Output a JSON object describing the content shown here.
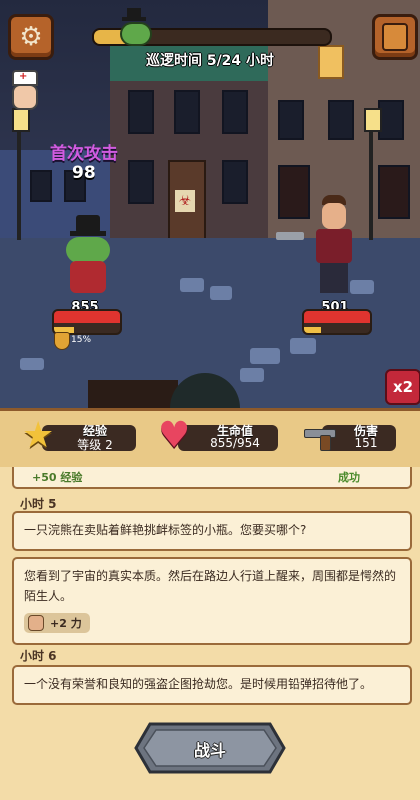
{
  "hud": {
    "patrol_label": "巡逻时间 5/24 小时",
    "patrol_progress": 0.21,
    "first_attack_label": "首次攻击",
    "first_attack_value": "98",
    "multiplier": "x2"
  },
  "player": {
    "hp": "855",
    "hp_fraction": 1.0,
    "energy_fraction": 0.3,
    "dodge": "15%"
  },
  "enemy": {
    "hp": "501",
    "hp_fraction": 1.0,
    "energy_fraction": 0.25
  },
  "stats": {
    "exp_label": "经验",
    "exp_value": "等级 2",
    "hp_label": "生命值",
    "hp_value": "855/954",
    "dmg_label": "伤害",
    "dmg_value": "151"
  },
  "log": {
    "partial_reward": "+50 经验",
    "partial_status": "成功",
    "entries": [
      {
        "hour": "小时 5",
        "text": "一只浣熊在卖贴着鲜艳挑衅标签的小瓶。您要买哪个?"
      },
      {
        "text": "您看到了宇宙的真实本质。然后在路边人行道上醒来，周围都是愕然的陌生人。",
        "reward": "+2 力"
      },
      {
        "hour": "小时 6",
        "text": "一个没有荣誉和良知的强盗企图抢劫您。是时候用铅弹招待他了。"
      }
    ]
  },
  "fight_button": "战斗",
  "colors": {
    "accent": "#e7b548",
    "hp_red": "#e0342f",
    "panel": "#f3dca8",
    "border": "#9a6a3a"
  }
}
